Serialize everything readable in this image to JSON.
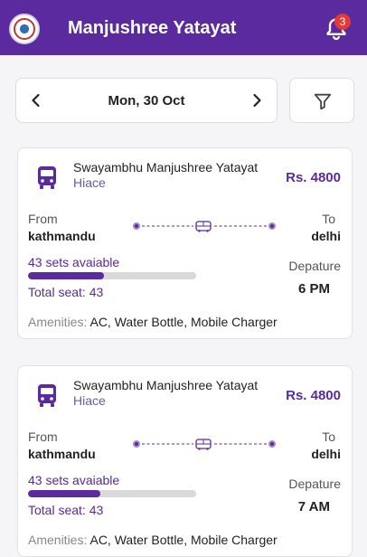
{
  "header": {
    "title": "Manjushree Yatayat",
    "notification_count": "3",
    "brand_color": "#5b2a9e"
  },
  "date_nav": {
    "date": "Mon, 30 Oct",
    "prev_icon": "chevron-left-icon",
    "next_icon": "chevron-right-icon",
    "filter_icon": "filter-icon"
  },
  "trips": [
    {
      "operator": "Swayambhu Manjushree Yatayat",
      "vehicle": "Hiace",
      "price": "Rs. 4800",
      "from_label": "From",
      "from": "kathmandu",
      "to_label": "To",
      "to": "delhi",
      "seats_available": "43 sets avaiable",
      "seat_fill_fraction": 0.45,
      "total_seat": "Total seat: 43",
      "departure_label": "Depature",
      "departure": "6 PM",
      "amenities_label": "Amenities:",
      "amenities": "AC, Water Bottle, Mobile Charger"
    },
    {
      "operator": "Swayambhu Manjushree Yatayat",
      "vehicle": "Hiace",
      "price": "Rs. 4800",
      "from_label": "From",
      "from": "kathmandu",
      "to_label": "To",
      "to": "delhi",
      "seats_available": "43 sets avaiable",
      "seat_fill_fraction": 0.43,
      "total_seat": "Total seat: 43",
      "departure_label": "Depature",
      "departure": "7 AM",
      "amenities_label": "Amenities:",
      "amenities": "AC, Water Bottle, Mobile Charger"
    }
  ]
}
